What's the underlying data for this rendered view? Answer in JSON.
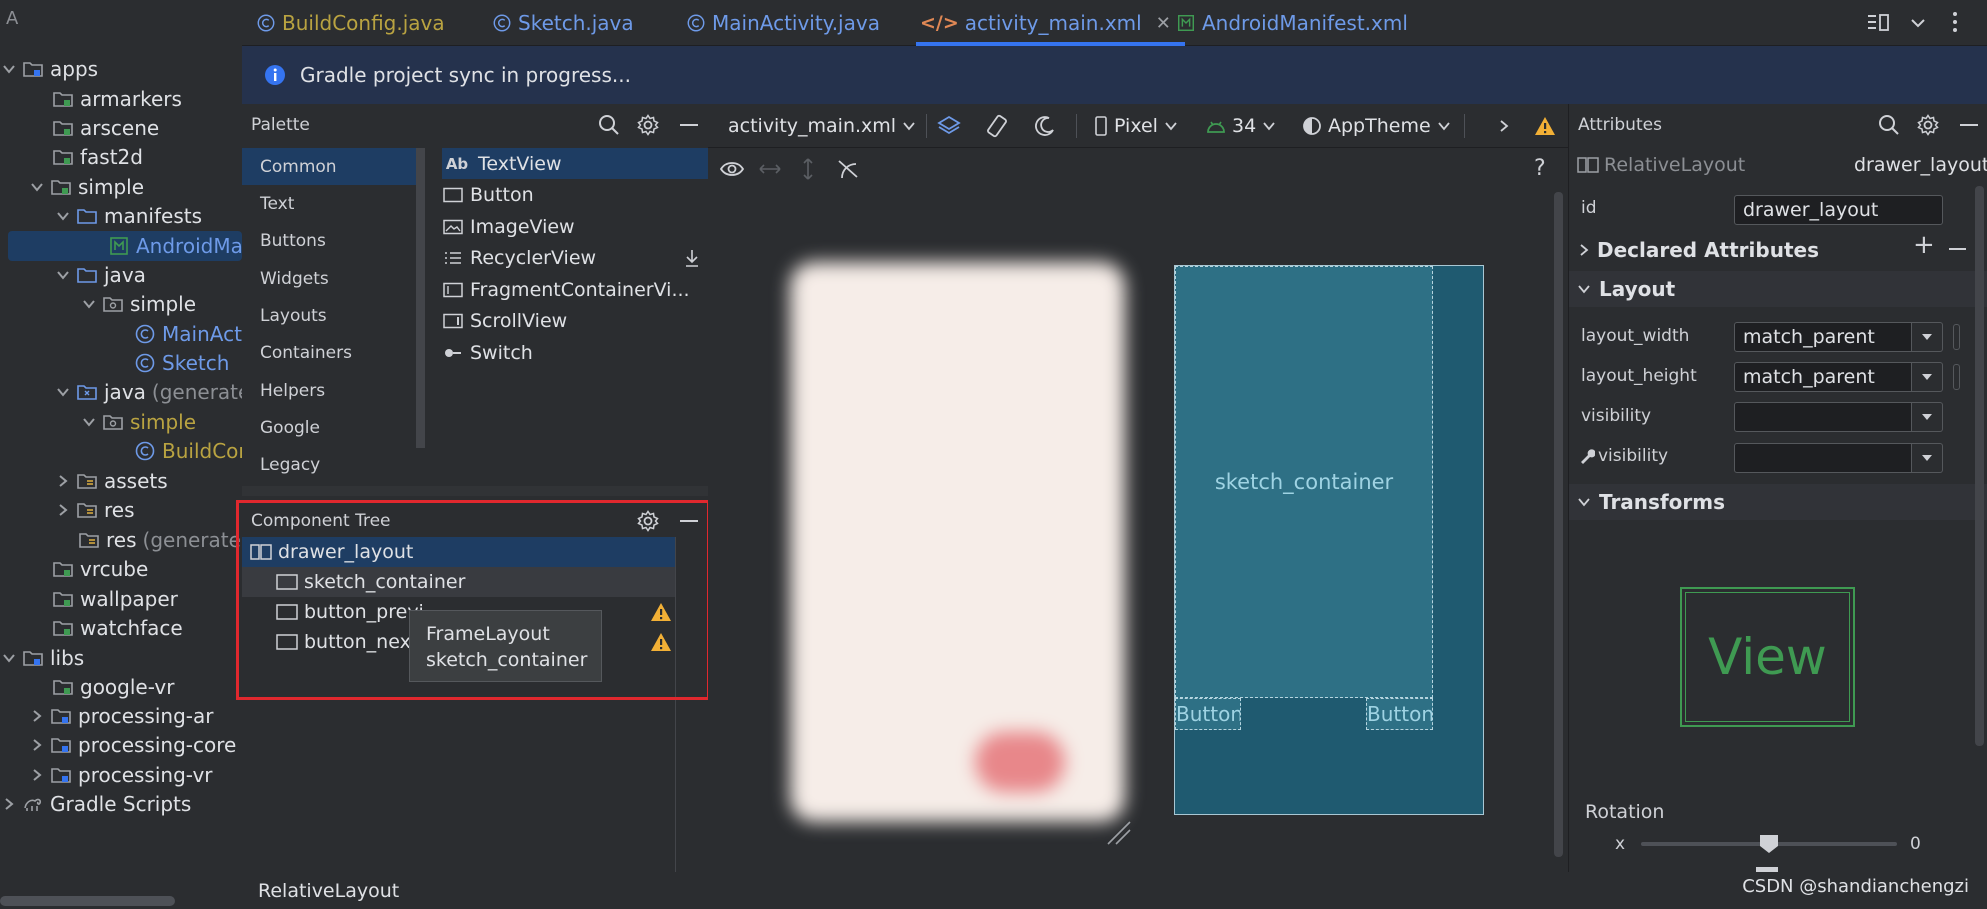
{
  "project_tree": {
    "items": [
      {
        "label": "apps",
        "extra": ""
      },
      {
        "label": "armarkers",
        "extra": ""
      },
      {
        "label": "arscene",
        "extra": ""
      },
      {
        "label": "fast2d",
        "extra": ""
      },
      {
        "label": "simple",
        "extra": ""
      },
      {
        "label": "manifests",
        "extra": ""
      },
      {
        "label": "AndroidManifest.xml",
        "extra": ""
      },
      {
        "label": "java",
        "extra": ""
      },
      {
        "label": "simple",
        "extra": ""
      },
      {
        "label": "MainActivity",
        "extra": ""
      },
      {
        "label": "Sketch",
        "extra": ""
      },
      {
        "label": "java",
        "extra": "(generated)"
      },
      {
        "label": "simple",
        "extra": ""
      },
      {
        "label": "BuildConfig",
        "extra": ""
      },
      {
        "label": "assets",
        "extra": ""
      },
      {
        "label": "res",
        "extra": ""
      },
      {
        "label": "res",
        "extra": "(generated)"
      },
      {
        "label": "vrcube",
        "extra": ""
      },
      {
        "label": "wallpaper",
        "extra": ""
      },
      {
        "label": "watchface",
        "extra": ""
      },
      {
        "label": "libs",
        "extra": ""
      },
      {
        "label": "google-vr",
        "extra": ""
      },
      {
        "label": "processing-ar",
        "extra": ""
      },
      {
        "label": "processing-core",
        "extra": ""
      },
      {
        "label": "processing-vr",
        "extra": ""
      },
      {
        "label": "Gradle Scripts",
        "extra": ""
      }
    ],
    "top_letter": "A"
  },
  "tabs": [
    {
      "label": "BuildConfig.java"
    },
    {
      "label": "Sketch.java"
    },
    {
      "label": "MainActivity.java"
    },
    {
      "label": "activity_main.xml"
    },
    {
      "label": "AndroidManifest.xml"
    }
  ],
  "banner": {
    "text": "Gradle project sync in progress..."
  },
  "palette": {
    "title": "Palette",
    "categories": [
      "Common",
      "Text",
      "Buttons",
      "Widgets",
      "Layouts",
      "Containers",
      "Helpers",
      "Google",
      "Legacy"
    ],
    "widgets": [
      "TextView",
      "Button",
      "ImageView",
      "RecyclerView",
      "FragmentContainerVi...",
      "ScrollView",
      "Switch"
    ],
    "textview_icon": "Ab"
  },
  "component_tree": {
    "title": "Component Tree",
    "items": [
      "drawer_layout",
      "sketch_container",
      "button_previ",
      "button_next"
    ]
  },
  "tooltip": {
    "line1": "FrameLayout",
    "line2": "sketch_container"
  },
  "design_toolbar": {
    "file": "activity_main.xml",
    "device": "Pixel",
    "api": "34",
    "theme": "AppTheme"
  },
  "blueprint": {
    "container_label": "sketch_container",
    "button_left": "Button",
    "button_right": "Button"
  },
  "attributes": {
    "title": "Attributes",
    "component_type": "RelativeLayout",
    "component_id": "drawer_layout",
    "id_label": "id",
    "id_value": "drawer_layout",
    "sections": {
      "declared": "Declared Attributes",
      "layout": "Layout",
      "transforms": "Transforms"
    },
    "layout_width_label": "layout_width",
    "layout_width_value": "match_parent",
    "layout_height_label": "layout_height",
    "layout_height_value": "match_parent",
    "visibility_label": "visibility",
    "visibility_tools_label": "visibility",
    "view_preview": "View",
    "rotation_label": "Rotation",
    "rotation_axis": "x",
    "rotation_value": "0",
    "rotation_fraction": 0.5
  },
  "status_bar": {
    "text": "RelativeLayout"
  },
  "watermark": "CSDN @shandianchengzi",
  "colors": {
    "accent": "#3574f0",
    "warning": "#f2b036",
    "highlight_border": "#e0282e",
    "blueprint_bg": "#1f5a70",
    "view_green": "#3f9a52"
  }
}
